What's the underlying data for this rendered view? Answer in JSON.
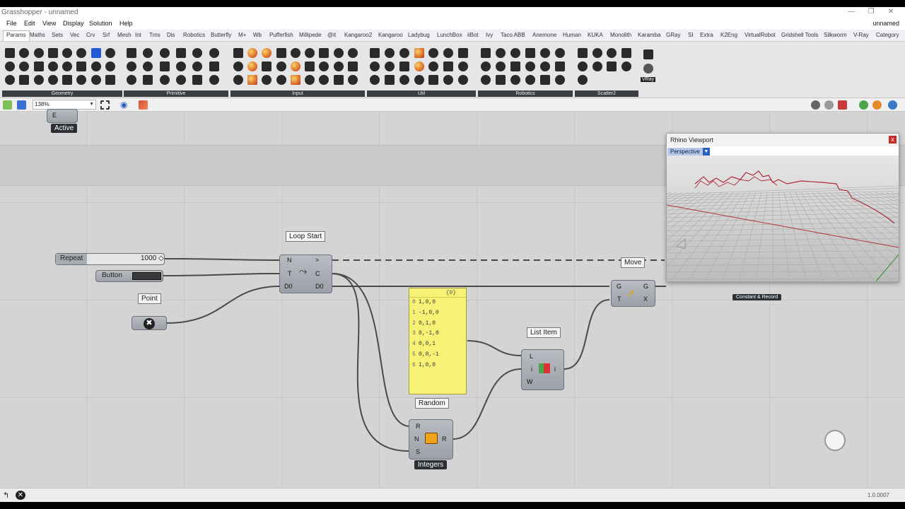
{
  "window": {
    "title": "Grasshopper - unnamed",
    "document_name": "unnamed"
  },
  "menu": [
    "File",
    "Edit",
    "View",
    "Display",
    "Solution",
    "Help"
  ],
  "tabs": [
    "Params",
    "Maths",
    "Sets",
    "Vec",
    "Crv",
    "Srf",
    "Mesh",
    "Int",
    "Trns",
    "Dis",
    "Robotics",
    "Butterfly",
    "M+",
    "Wb",
    "Pufferfish",
    "Millipede",
    "@it",
    "Kangaroo2",
    "Kangaroo",
    "Ladybug",
    "LunchBox",
    "iiBot",
    "Ivy",
    "Taco ABB",
    "Anemone",
    "Human",
    "KUKA",
    "Monolith",
    "Karamba",
    "GRay",
    "SI",
    "Extra",
    "K2Eng",
    "VirtualRobot",
    "Gridshell Tools",
    "Silkworm",
    "V-Ray",
    "Category"
  ],
  "active_tab": "Params",
  "ribbon_groups": [
    "Geometry",
    "Primitive",
    "Input",
    "Util",
    "Robotics",
    "Scatter2"
  ],
  "ribbon_vray_label": "VRay",
  "zoom": "138%",
  "canvas": {
    "active_node": {
      "port": "E",
      "tag": "Active"
    },
    "repeat": {
      "label": "Repeat",
      "value": "1000 ◇"
    },
    "button": {
      "label": "Button"
    },
    "point": {
      "label": "Point"
    },
    "loop_start": {
      "label": "Loop Start",
      "inputs": [
        "N",
        "T",
        "D0"
      ],
      "outputs": [
        ">",
        "C",
        "D0"
      ]
    },
    "panel": {
      "header": "{0}",
      "rows": [
        {
          "i": "0",
          "v": "1,0,0"
        },
        {
          "i": "1",
          "v": "-1,0,0"
        },
        {
          "i": "2",
          "v": "0,1,0"
        },
        {
          "i": "3",
          "v": "0,-1,0"
        },
        {
          "i": "4",
          "v": "0,0,1"
        },
        {
          "i": "5",
          "v": "0,0,-1"
        },
        {
          "i": "6",
          "v": "1,0,0"
        }
      ]
    },
    "list_item": {
      "label": "List Item",
      "inputs": [
        "L",
        "i",
        "W"
      ],
      "outputs": [
        "i"
      ]
    },
    "random": {
      "label": "Random",
      "inputs": [
        "R",
        "N",
        "S"
      ],
      "outputs": [
        "R"
      ],
      "tag": "Integers"
    },
    "move": {
      "label": "Move",
      "inputs": [
        "G",
        "T"
      ],
      "outputs": [
        "G",
        "X"
      ]
    },
    "constant_record": "Constant & Record"
  },
  "viewport": {
    "title": "Rhino Viewport",
    "view": "Perspective",
    "close": "x"
  },
  "status": {
    "version": "1.0.0007"
  },
  "colors": {
    "accent": "#1f57d6",
    "panel": "#f7f275",
    "wire": "#4a4a4a"
  }
}
